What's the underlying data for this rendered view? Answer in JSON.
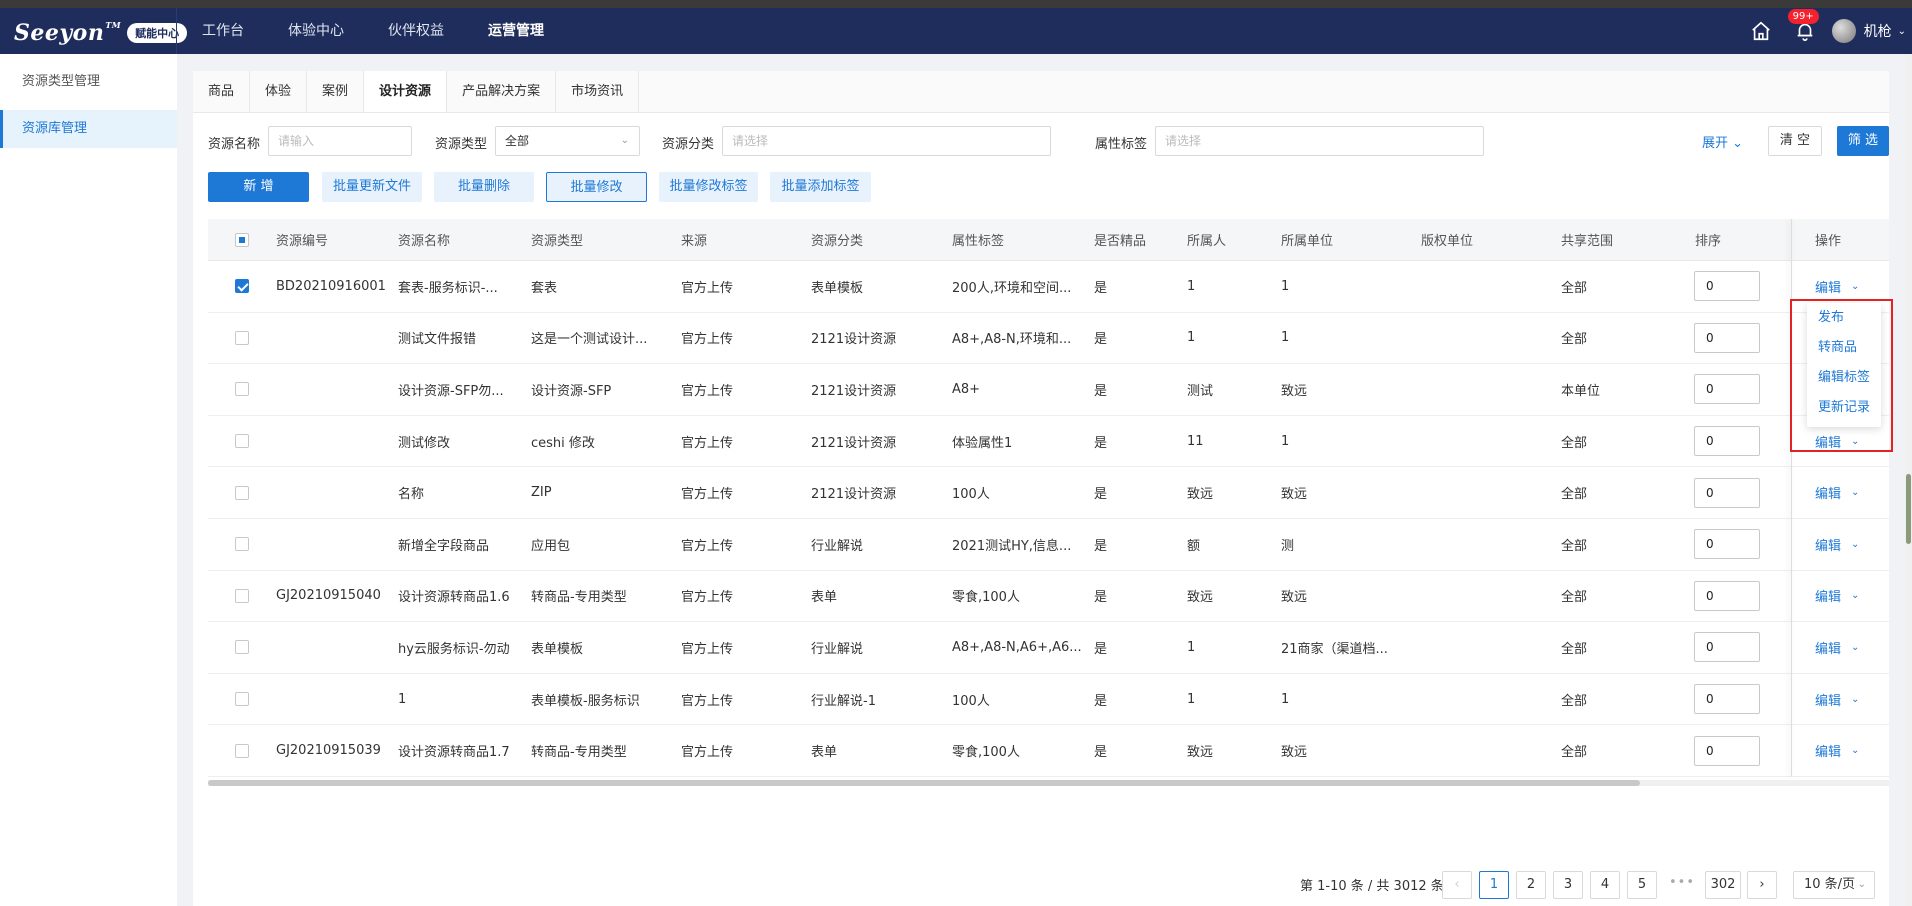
{
  "topbar": {
    "logo_text": "Seeyon",
    "logo_sup": "TM",
    "logo_badge": "赋能中心",
    "nav": [
      "工作台",
      "体验中心",
      "伙伴权益",
      "运营管理"
    ],
    "active_nav": 3,
    "notification_badge": "99+",
    "username": "机枪"
  },
  "sidebar": {
    "items": [
      "资源类型管理",
      "资源库管理"
    ],
    "active": 1
  },
  "tabs": {
    "items": [
      "商品",
      "体验",
      "案例",
      "设计资源",
      "产品解决方案",
      "市场资讯"
    ],
    "active": 3
  },
  "filters": {
    "name_label": "资源名称",
    "name_placeholder": "请输入",
    "type_label": "资源类型",
    "type_value": "全部",
    "category_label": "资源分类",
    "category_placeholder": "请选择",
    "tag_label": "属性标签",
    "tag_placeholder": "请选择",
    "expand_label": "展开",
    "clear_label": "清 空",
    "filter_label": "筛 选"
  },
  "actions": {
    "add": "新 增",
    "batch_update_file": "批量更新文件",
    "batch_delete": "批量删除",
    "batch_edit": "批量修改",
    "batch_edit_tag": "批量修改标签",
    "batch_add_tag": "批量添加标签"
  },
  "table": {
    "headers": [
      "资源编号",
      "资源名称",
      "资源类型",
      "来源",
      "资源分类",
      "属性标签",
      "是否精品",
      "所属人",
      "所属单位",
      "版权单位",
      "共享范围",
      "排序",
      "操作"
    ],
    "edit_label": "编辑",
    "rows": [
      {
        "checked": true,
        "code": "BD20210916001",
        "name": "套表-服务标识-...",
        "type": "套表",
        "source": "官方上传",
        "category": "表单模板",
        "tags": "200人,环境和空间...",
        "premium": "是",
        "owner": "1",
        "unit": "1",
        "copyright": "",
        "scope": "全部",
        "sort": "0"
      },
      {
        "checked": false,
        "code": "",
        "name": "测试文件报错",
        "type": "这是一个测试设计...",
        "source": "官方上传",
        "category": "2121设计资源",
        "tags": "A8+,A8-N,环境和...",
        "premium": "是",
        "owner": "1",
        "unit": "1",
        "copyright": "",
        "scope": "全部",
        "sort": "0"
      },
      {
        "checked": false,
        "code": "",
        "name": "设计资源-SFP勿...",
        "type": "设计资源-SFP",
        "source": "官方上传",
        "category": "2121设计资源",
        "tags": "A8+",
        "premium": "是",
        "owner": "测试",
        "unit": "致远",
        "copyright": "",
        "scope": "本单位",
        "sort": "0"
      },
      {
        "checked": false,
        "code": "",
        "name": "测试修改",
        "type": "ceshi 修改",
        "source": "官方上传",
        "category": "2121设计资源",
        "tags": "体验属性1",
        "premium": "是",
        "owner": "11",
        "unit": "1",
        "copyright": "",
        "scope": "全部",
        "sort": "0"
      },
      {
        "checked": false,
        "code": "",
        "name": "名称",
        "type": "ZIP",
        "source": "官方上传",
        "category": "2121设计资源",
        "tags": "100人",
        "premium": "是",
        "owner": "致远",
        "unit": "致远",
        "copyright": "",
        "scope": "全部",
        "sort": "0"
      },
      {
        "checked": false,
        "code": "",
        "name": "新增全字段商品",
        "type": "应用包",
        "source": "官方上传",
        "category": "行业解说",
        "tags": "2021测试HY,信息...",
        "premium": "是",
        "owner": "额",
        "unit": "测",
        "copyright": "",
        "scope": "全部",
        "sort": "0"
      },
      {
        "checked": false,
        "code": "GJ20210915040",
        "name": "设计资源转商品1.6",
        "type": "转商品-专用类型",
        "source": "官方上传",
        "category": "表单",
        "tags": "零食,100人",
        "premium": "是",
        "owner": "致远",
        "unit": "致远",
        "copyright": "",
        "scope": "全部",
        "sort": "0"
      },
      {
        "checked": false,
        "code": "",
        "name": "hy云服务标识-勿动",
        "type": "表单模板",
        "source": "官方上传",
        "category": "行业解说",
        "tags": "A8+,A8-N,A6+,A6...",
        "premium": "是",
        "owner": "1",
        "unit": "21商家（渠道档...",
        "copyright": "",
        "scope": "全部",
        "sort": "0"
      },
      {
        "checked": false,
        "code": "",
        "name": "1",
        "type": "表单模板-服务标识",
        "source": "官方上传",
        "category": "行业解说-1",
        "tags": "100人",
        "premium": "是",
        "owner": "1",
        "unit": "1",
        "copyright": "",
        "scope": "全部",
        "sort": "0"
      },
      {
        "checked": false,
        "code": "GJ20210915039",
        "name": "设计资源转商品1.7",
        "type": "转商品-专用类型",
        "source": "官方上传",
        "category": "表单",
        "tags": "零食,100人",
        "premium": "是",
        "owner": "致远",
        "unit": "致远",
        "copyright": "",
        "scope": "全部",
        "sort": "0"
      }
    ]
  },
  "dropdown": {
    "items": [
      "发布",
      "转商品",
      "编辑标签",
      "更新记录"
    ]
  },
  "pagination": {
    "info": "第 1-10 条 / 共 3012 条",
    "pages": [
      "1",
      "2",
      "3",
      "4",
      "5"
    ],
    "ellipsis": "•••",
    "last_page": "302",
    "current": "1",
    "page_size": "10 条/页"
  }
}
